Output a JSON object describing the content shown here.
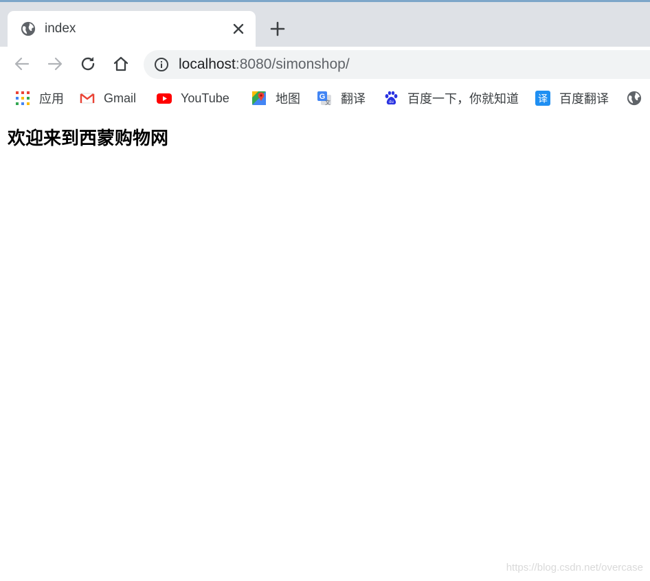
{
  "browser": {
    "tab": {
      "title": "index",
      "favicon": "globe-icon"
    },
    "url": {
      "host": "localhost",
      "rest": ":8080/simonshop/"
    }
  },
  "bookmarks": [
    {
      "label": "应用",
      "icon": "apps-grid-icon"
    },
    {
      "label": "Gmail",
      "icon": "gmail-icon"
    },
    {
      "label": "YouTube",
      "icon": "youtube-icon"
    },
    {
      "label": "地图",
      "icon": "maps-icon"
    },
    {
      "label": "翻译",
      "icon": "google-translate-icon"
    },
    {
      "label": "百度一下，你就知道",
      "icon": "baidu-paw-icon"
    },
    {
      "label": "百度翻译",
      "icon": "baidu-translate-icon"
    }
  ],
  "page": {
    "heading": "欢迎来到西蒙购物网"
  },
  "watermark": "https://blog.csdn.net/overcase",
  "colors": {
    "tabstrip": "#dee1e6",
    "omnibox": "#f1f3f4",
    "youtube_red": "#ff0000",
    "baidu_blue": "#2932e1",
    "translate_blue": "#1f8ff2"
  }
}
